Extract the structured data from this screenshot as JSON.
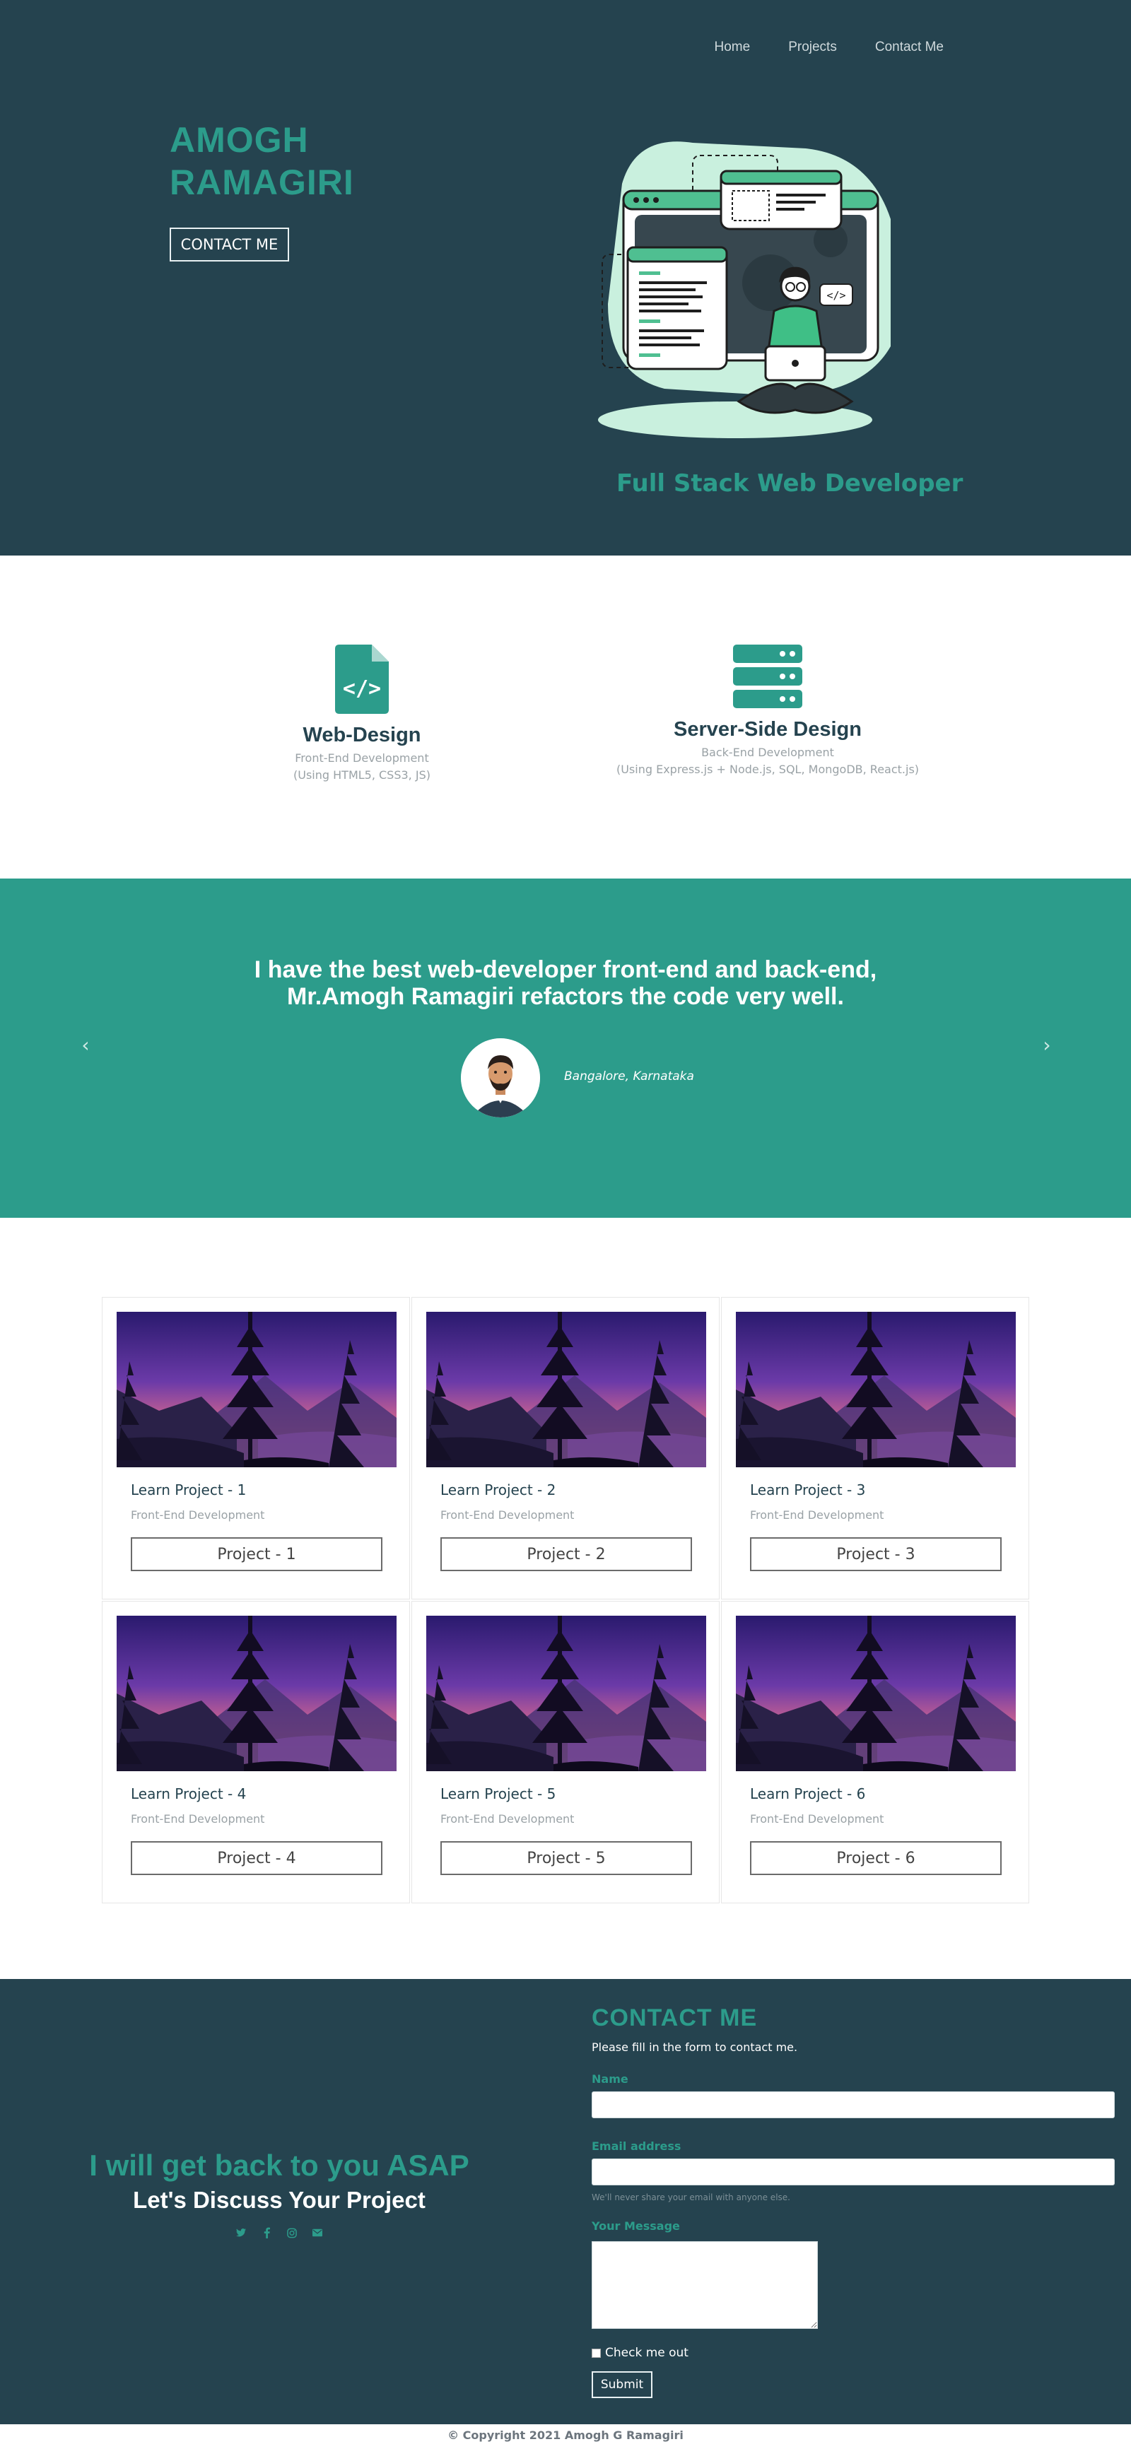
{
  "nav": {
    "items": [
      "Home",
      "Projects",
      "Contact Me"
    ]
  },
  "hero": {
    "name_line1": "AMOGH",
    "name_line2": "RAMAGIRI",
    "contact_button": "CONTACT ME",
    "role": "Full Stack Web Developer"
  },
  "services": [
    {
      "title": "Web-Design",
      "line1": "Front-End Development",
      "line2": "(Using HTML5, CSS3, JS)",
      "icon": "code-file-icon"
    },
    {
      "title": "Server-Side Design",
      "line1": "Back-End Development",
      "line2": "(Using Express.js + Node.js, SQL, MongoDB, React.js)",
      "icon": "server-icon"
    }
  ],
  "testimonial": {
    "quote_line1": "I have the best web-developer front-end and back-end,",
    "quote_line2": "Mr.Amogh Ramagiri refactors the code very well.",
    "location": "Bangalore, Karnataka",
    "prev_icon": "chevron-left-icon",
    "next_icon": "chevron-right-icon"
  },
  "projects": [
    {
      "title": "Learn Project - 1",
      "subtitle": "Front-End Development",
      "button": "Project - 1"
    },
    {
      "title": "Learn Project - 2",
      "subtitle": "Front-End Development",
      "button": "Project - 2"
    },
    {
      "title": "Learn Project - 3",
      "subtitle": "Front-End Development",
      "button": "Project - 3"
    },
    {
      "title": "Learn Project - 4",
      "subtitle": "Front-End Development",
      "button": "Project - 4"
    },
    {
      "title": "Learn Project - 5",
      "subtitle": "Front-End Development",
      "button": "Project - 5"
    },
    {
      "title": "Learn Project - 6",
      "subtitle": "Front-End Development",
      "button": "Project - 6"
    }
  ],
  "contact": {
    "asap": "I will get back to you ASAP",
    "discuss": "Let's Discuss Your Project",
    "social_icons": [
      "twitter-icon",
      "facebook-icon",
      "instagram-icon",
      "email-icon"
    ],
    "form_title": "CONTACT ME",
    "intro": "Please fill in the form to contact me.",
    "name_label": "Name",
    "email_label": "Email address",
    "email_help": "We'll never share your email with anyone else.",
    "message_label": "Your Message",
    "check_label": "Check me out",
    "submit": "Submit"
  },
  "footer": {
    "copyright": "© Copyright 2021 Amogh G Ramagiri"
  },
  "colors": {
    "navy": "#25434f",
    "teal": "#2c9c8b",
    "white": "#ffffff"
  }
}
